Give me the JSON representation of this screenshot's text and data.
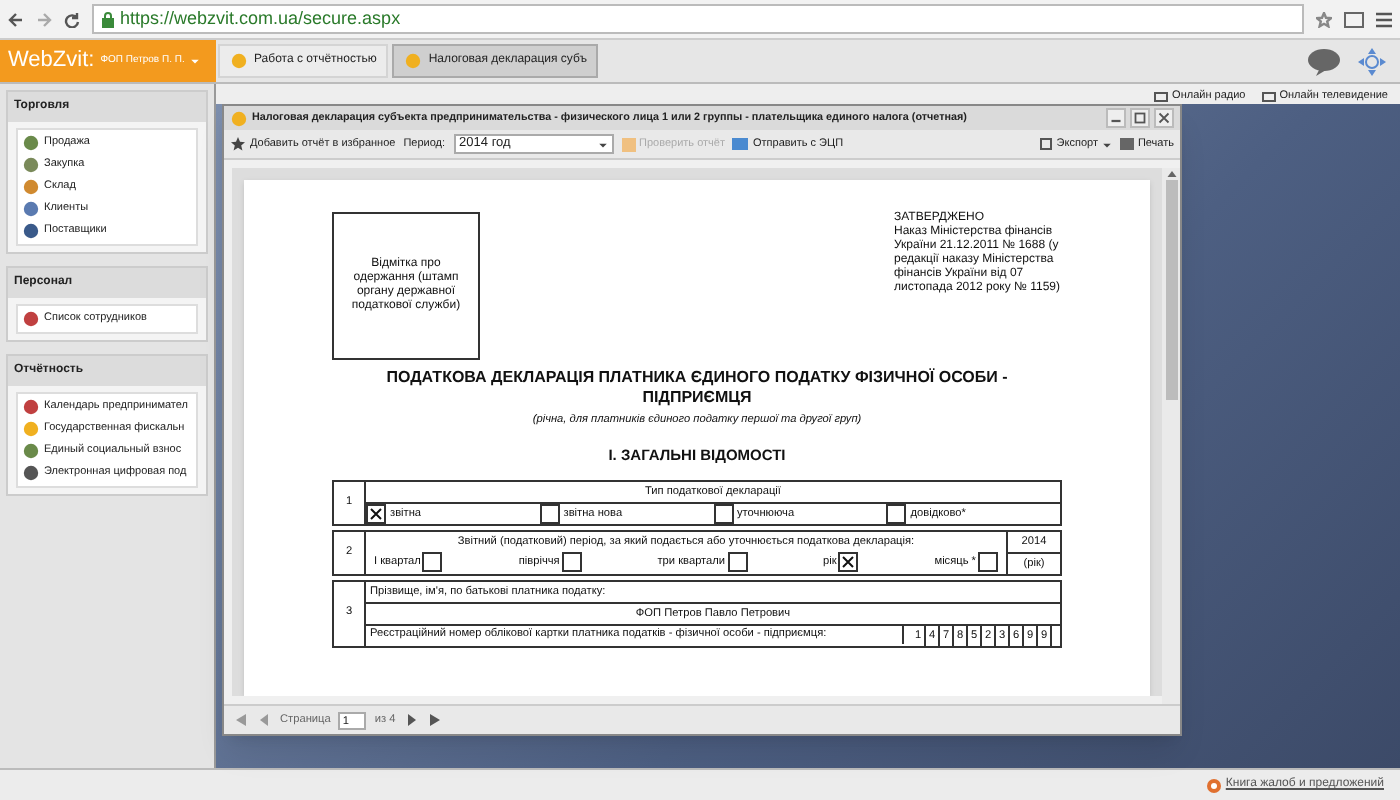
{
  "browser": {
    "url": "https://webzvit.com.ua/secure.aspx"
  },
  "app": {
    "logo": "WebZvit:",
    "user": "ФОП Петров П. П.",
    "tabs": [
      {
        "label": "Работа с отчётностью",
        "selected": false
      },
      {
        "label": "Налоговая декларация субъ",
        "selected": true
      }
    ],
    "links": [
      "Онлайн радио",
      "Онлайн телевидение"
    ]
  },
  "sidebar": [
    {
      "title": "Торговля",
      "items": [
        "Продажа",
        "Закупка",
        "Склад",
        "Клиенты",
        "Поставщики"
      ]
    },
    {
      "title": "Персонал",
      "items": [
        "Список сотрудников"
      ]
    },
    {
      "title": "Отчётность",
      "items": [
        "Календарь предпринимател",
        "Государственная фискальн",
        "Единый социальный взнос",
        "Электронная цифровая под"
      ]
    }
  ],
  "dialog": {
    "title": "Налоговая декларация субъекта предпринимательства - физического лица 1 или 2 группы - плательщика единого налога (отчетная)",
    "toolbar": {
      "favorite": "Добавить отчёт в избранное",
      "period_label": "Период:",
      "period_value": "2014 год",
      "check": {
        "label": "Проверить отчёт",
        "disabled": true
      },
      "send": "Отправить с ЭЦП",
      "export": "Экспорт",
      "print": "Печать"
    },
    "document": {
      "stamp": "Відмітка про одержання (штамп органу державної податкової служби)",
      "approved_title": "ЗАТВЕРДЖЕНО",
      "approved_text": "Наказ Міністерства фінансів України 21.12.2011 № 1688 (у редакції наказу Міністерства фінансів України від 07 листопада 2012 року № 1159)",
      "title": "ПОДАТКОВА ДЕКЛАРАЦІЯ ПЛАТНИКА ЄДИНОГО ПОДАТКУ ФІЗИЧНОЇ ОСОБИ - ПІДПРИЄМЦЯ",
      "subtitle": "(річна, для платників єдиного податку першої та другої груп)",
      "section": "I. ЗАГАЛЬНІ ВІДОМОСТІ",
      "rows": [
        {
          "kind": "type",
          "number": "1",
          "heading": "Тип податкової декларації",
          "options": [
            {
              "label": "звітна",
              "checked": true
            },
            {
              "label": "звітна нова",
              "checked": false
            },
            {
              "label": "уточнююча",
              "checked": false
            },
            {
              "label": "довідково*",
              "checked": false
            }
          ]
        },
        {
          "kind": "period",
          "number": "2",
          "heading": "Звітний (податковий) період, за який подається або уточнюється податкова декларація:",
          "options": [
            {
              "label": "I квартал",
              "checked": false
            },
            {
              "label": "півріччя",
              "checked": false
            },
            {
              "label": "три квартали",
              "checked": false
            },
            {
              "label": "рік",
              "checked": true
            },
            {
              "label": "місяць *",
              "checked": false
            }
          ],
          "year": "2014",
          "year_label": "(рік)"
        },
        {
          "kind": "payer",
          "number": "3",
          "name_label": "Прізвище, ім'я, по батькові платника податку:",
          "name": "ФОП Петров Павло Петрович",
          "reg_label": "Реєстраційний номер облікової картки платника податків - фізичної особи - підприємця:",
          "reg_digits": [
            "1",
            "4",
            "7",
            "8",
            "5",
            "2",
            "3",
            "6",
            "9",
            "9"
          ]
        }
      ]
    },
    "pager": {
      "label": "Страница",
      "page": "1",
      "total": "из 4"
    }
  },
  "footer": {
    "link": "Книга жалоб и предложений"
  }
}
